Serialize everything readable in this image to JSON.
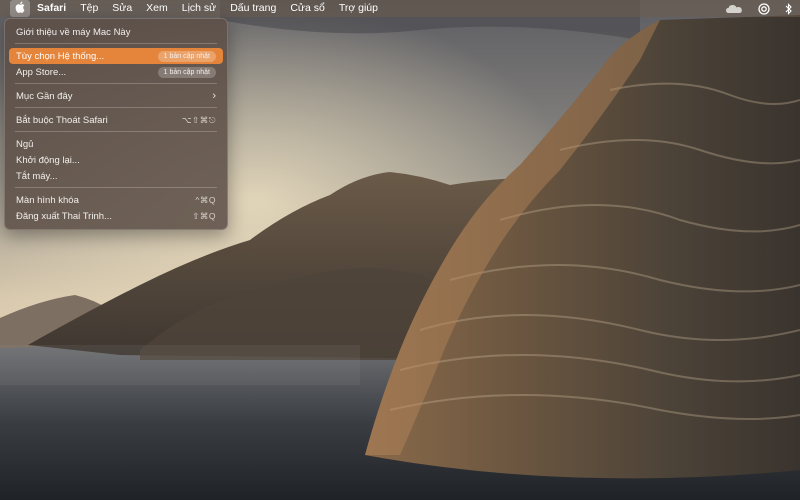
{
  "menubar": {
    "apple_icon": "apple-logo-icon",
    "items": [
      "Safari",
      "Tệp",
      "Sửa",
      "Xem",
      "Lịch sử",
      "Dấu trang",
      "Cửa sổ",
      "Trợ giúp"
    ],
    "status_icons": [
      "icloud-sync-icon",
      "creative-cloud-icon",
      "bluetooth-icon"
    ]
  },
  "apple_menu": {
    "about": "Giới thiệu về máy Mac Này",
    "system_prefs": "Tùy chọn Hệ thống...",
    "system_prefs_badge": "1 bản cập nhật",
    "app_store": "App Store...",
    "app_store_badge": "1 bản cập nhật",
    "recent_items": "Mục Gần đây",
    "force_quit": "Bắt buộc Thoát Safari",
    "force_quit_shortcut": "⌥⇧⌘⎋",
    "sleep": "Ngủ",
    "restart": "Khởi động lại...",
    "shutdown": "Tắt máy...",
    "lock_screen": "Màn hình khóa",
    "lock_screen_shortcut": "^⌘Q",
    "logout": "Đăng xuất Thai Trinh...",
    "logout_shortcut": "⇧⌘Q"
  },
  "colors": {
    "highlight": "#e5843b",
    "menu_bg": "#5c4e46"
  },
  "wallpaper": "macOS Catalina island cliffs at sunset"
}
